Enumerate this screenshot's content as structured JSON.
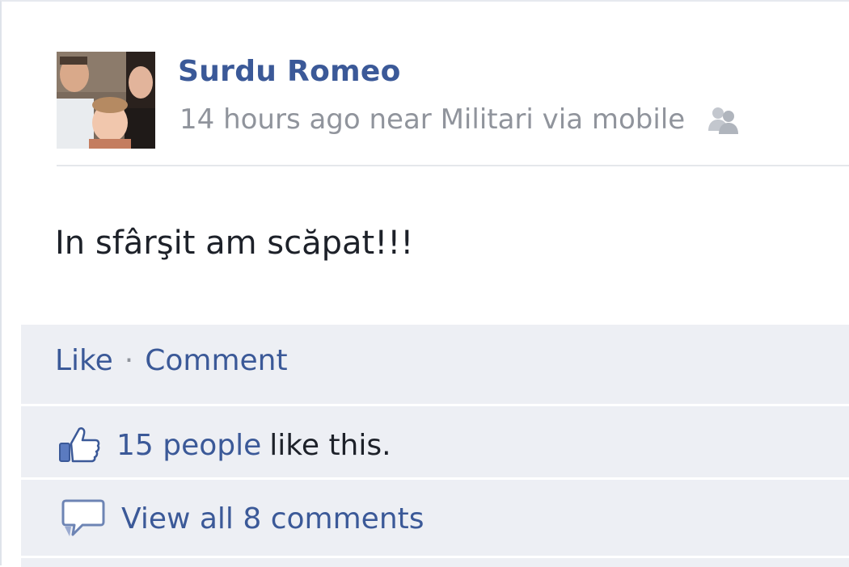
{
  "post": {
    "author": "Surdu Romeo",
    "meta": "14 hours ago near Militari via mobile",
    "privacy_icon": "friends-icon",
    "text": "In sfârşit am scăpat!!!"
  },
  "actions": {
    "like_label": "Like",
    "separator": "·",
    "comment_label": "Comment"
  },
  "likes": {
    "icon": "thumbs-up-icon",
    "count_text": "15 people",
    "suffix": "like this."
  },
  "comments": {
    "icon": "comment-bubble-icon",
    "view_all": "View all 8 comments"
  },
  "colors": {
    "link": "#3b5998",
    "meta": "#90949c",
    "ufi_background": "#edeff4"
  }
}
